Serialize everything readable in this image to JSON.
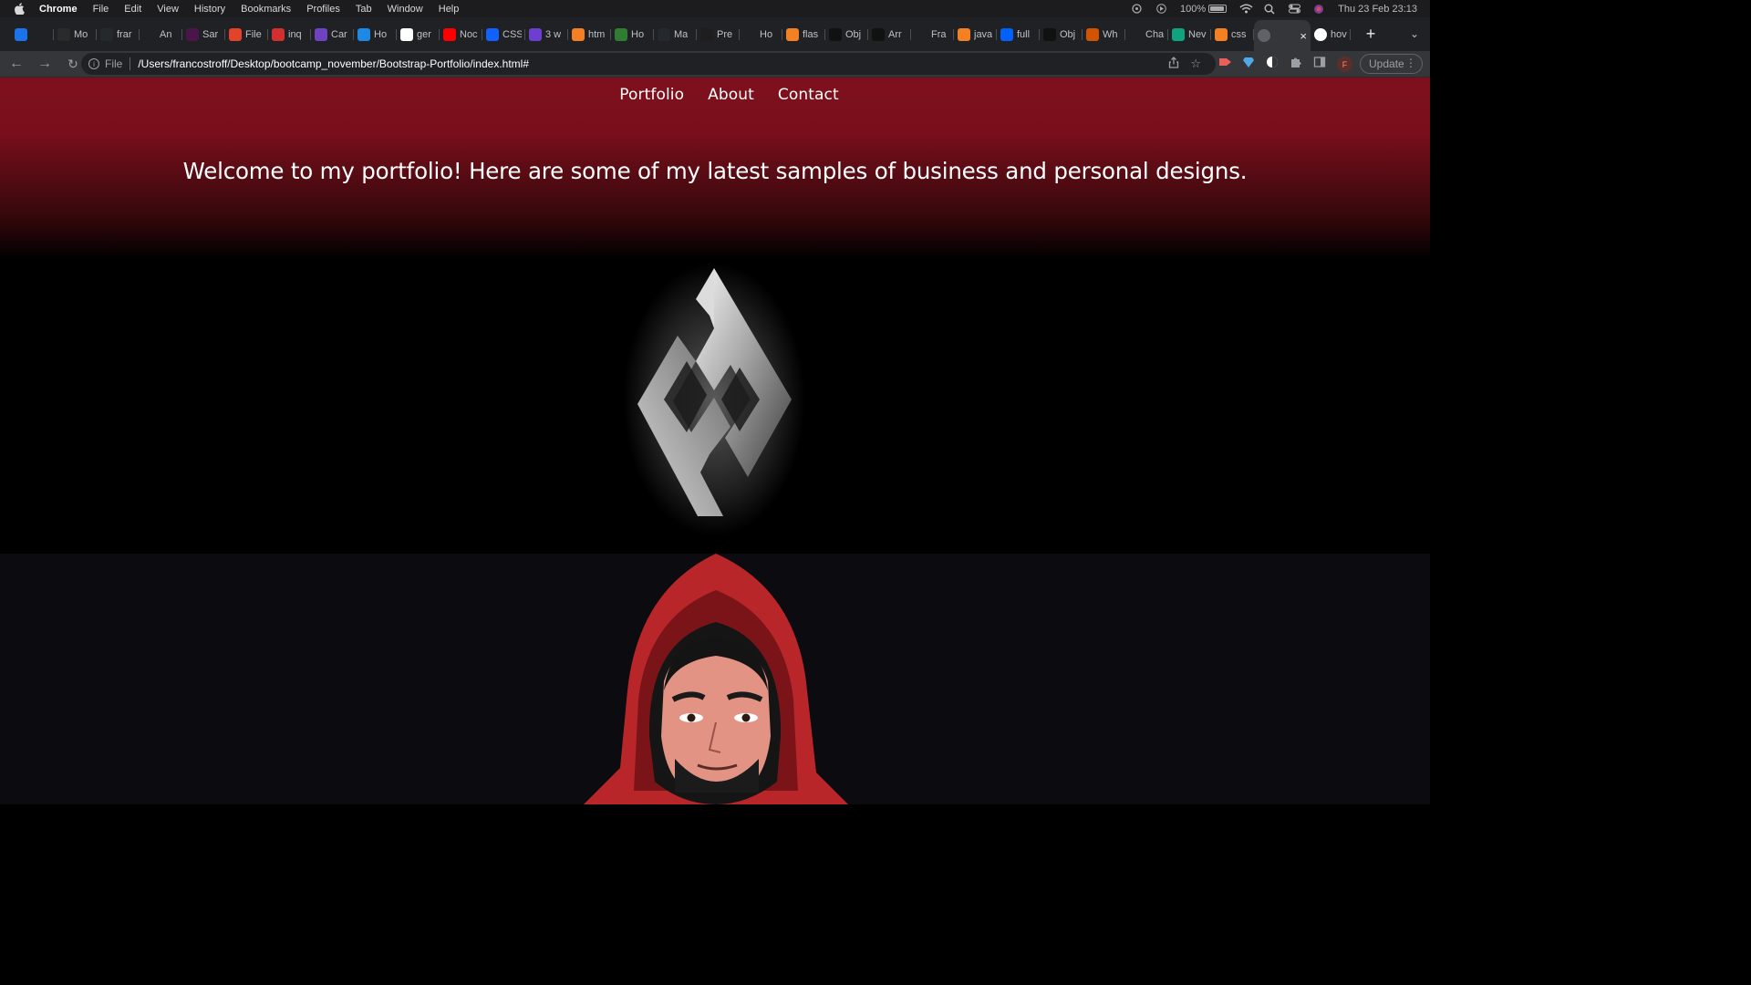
{
  "menubar": {
    "app_name": "Chrome",
    "menus": [
      "File",
      "Edit",
      "View",
      "History",
      "Bookmarks",
      "Profiles",
      "Tab",
      "Window",
      "Help"
    ],
    "battery": "100%",
    "datetime": "Thu 23 Feb  23:13"
  },
  "tabs": [
    {
      "label": "",
      "icon": "gem-icon",
      "color": "#1a73e8"
    },
    {
      "label": "Mo",
      "icon": "wix-icon",
      "color": "#2b2b2b"
    },
    {
      "label": "frar",
      "icon": "github-icon",
      "color": "#24292e"
    },
    {
      "label": "An",
      "icon": "openai-icon",
      "color": "#202124"
    },
    {
      "label": "Sar",
      "icon": "slack-icon",
      "color": "#4a154b"
    },
    {
      "label": "File",
      "icon": "gitlab-icon",
      "color": "#e24329"
    },
    {
      "label": "inq",
      "icon": "inquirer-icon",
      "color": "#d32f2f"
    },
    {
      "label": "Car",
      "icon": "bootstrap-icon",
      "color": "#6f42c1"
    },
    {
      "label": "Ho",
      "icon": "browser-icon",
      "color": "#1e88e5"
    },
    {
      "label": "ger",
      "icon": "google-icon",
      "color": "#ffffff"
    },
    {
      "label": "Noc",
      "icon": "youtube-icon",
      "color": "#ff0000"
    },
    {
      "label": "CSS",
      "icon": "edge-icon",
      "color": "#0f62fe"
    },
    {
      "label": "3 w",
      "icon": "a-icon",
      "color": "#6c3fd1"
    },
    {
      "label": "htm",
      "icon": "stackoverflow-icon",
      "color": "#f48024"
    },
    {
      "label": "Ho",
      "icon": "link-icon",
      "color": "#2e7d32"
    },
    {
      "label": "Ma",
      "icon": "github-icon",
      "color": "#24292e"
    },
    {
      "label": "Pre",
      "icon": "figma-icon",
      "color": "#1e1e1e"
    },
    {
      "label": "Ho",
      "icon": "blank-icon",
      "color": "#202124"
    },
    {
      "label": "flas",
      "icon": "stackoverflow-icon",
      "color": "#f48024"
    },
    {
      "label": "Obj",
      "icon": "mdn-icon",
      "color": "#111111"
    },
    {
      "label": "Arr",
      "icon": "mdn-icon",
      "color": "#111111"
    },
    {
      "label": "Fra",
      "icon": "blank-icon",
      "color": "#202124"
    },
    {
      "label": "java",
      "icon": "stackoverflow-icon",
      "color": "#f48024"
    },
    {
      "label": "full",
      "icon": "dropbox-icon",
      "color": "#0061fe"
    },
    {
      "label": "Obj",
      "icon": "mdn-icon",
      "color": "#111111"
    },
    {
      "label": "Wh",
      "icon": "w3-icon",
      "color": "#d35400"
    },
    {
      "label": "Cha",
      "icon": "openai-icon",
      "color": "#202124"
    },
    {
      "label": "Nev",
      "icon": "chatgpt-icon",
      "color": "#10a37f"
    },
    {
      "label": "css",
      "icon": "stackoverflow-icon",
      "color": "#f48024"
    }
  ],
  "active_tab": {
    "label": "",
    "icon": "globe-icon"
  },
  "current_tab": {
    "label": "hov",
    "icon": "google-icon"
  },
  "toolbar": {
    "scheme": "File",
    "url": "/Users/francostroff/Desktop/bootcamp_november/Bootstrap-Portfolio/index.html#",
    "profile_initial": "F",
    "update_label": "Update"
  },
  "page": {
    "nav": [
      "Portfolio",
      "About",
      "Contact"
    ],
    "welcome": "Welcome to my portfolio! Here are some of my latest samples of business and personal designs."
  },
  "colors": {
    "hero_top": "#7e101d",
    "hero_bottom": "#000000",
    "avatar_bg": "#0c0b10",
    "hood": "#b8262a"
  }
}
